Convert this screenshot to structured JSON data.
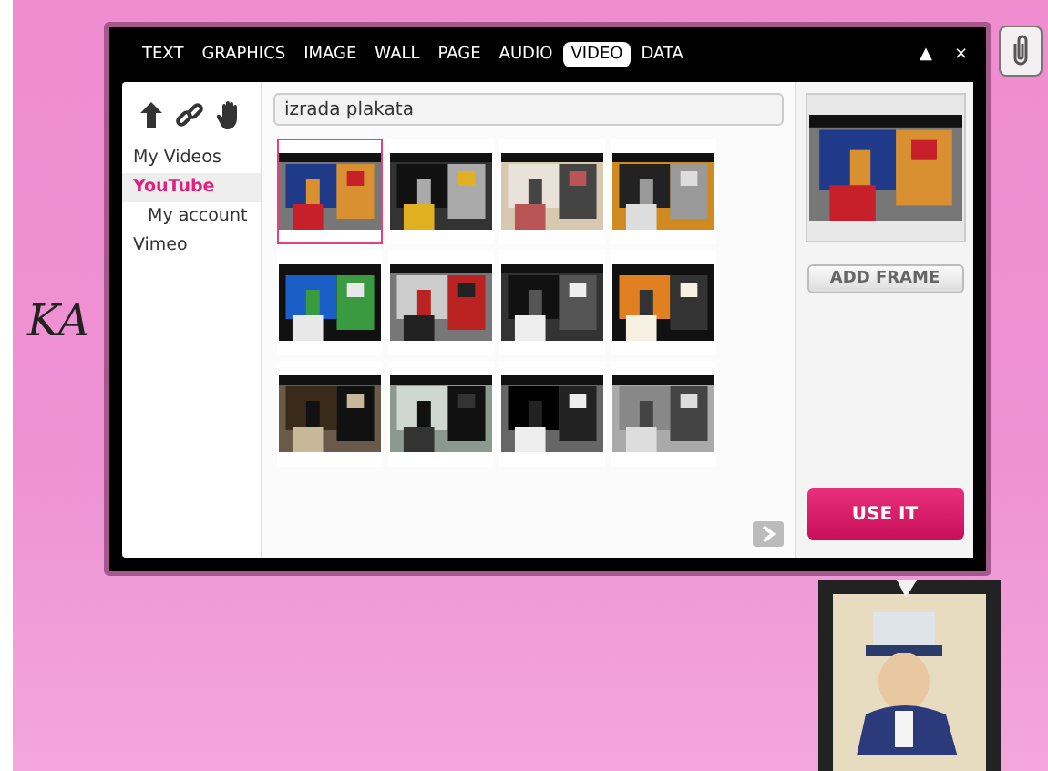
{
  "canvas_text": "KA",
  "window": {
    "tabs": [
      {
        "label": "TEXT",
        "selected": false
      },
      {
        "label": "GRAPHICS",
        "selected": false
      },
      {
        "label": "IMAGE",
        "selected": false
      },
      {
        "label": "WALL",
        "selected": false
      },
      {
        "label": "PAGE",
        "selected": false
      },
      {
        "label": "AUDIO",
        "selected": false
      },
      {
        "label": "VIDEO",
        "selected": true
      },
      {
        "label": "DATA",
        "selected": false
      }
    ],
    "controls": [
      "▲",
      "×"
    ]
  },
  "sidebar": {
    "items": [
      {
        "label": "My Videos",
        "selected": false
      },
      {
        "label": "YouTube",
        "selected": true,
        "children": [
          {
            "label": "My account",
            "selected": false
          }
        ]
      },
      {
        "label": "Vimeo",
        "selected": false
      }
    ]
  },
  "search": {
    "value": "izrada plakata"
  },
  "videos": [
    {
      "kind": "picture",
      "selected": true
    },
    {
      "kind": "picture",
      "selected": false
    },
    {
      "kind": "picture",
      "selected": false
    },
    {
      "kind": "picture",
      "selected": false
    },
    {
      "kind": "picture",
      "selected": false
    },
    {
      "kind": "picture",
      "selected": false
    },
    {
      "kind": "picture",
      "selected": false
    },
    {
      "kind": "picture",
      "selected": false
    },
    {
      "kind": "picture",
      "selected": false
    },
    {
      "kind": "picture",
      "selected": false
    },
    {
      "kind": "picture",
      "selected": false
    },
    {
      "kind": "picture",
      "selected": false
    }
  ],
  "preview": {
    "kind": "picture"
  },
  "buttons": {
    "add_frame": "ADD FRAME",
    "use": "USE IT"
  }
}
